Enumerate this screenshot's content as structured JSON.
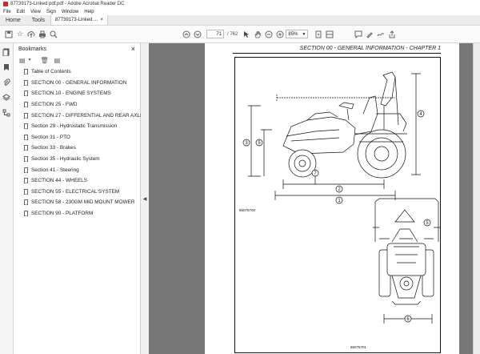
{
  "window": {
    "title": "87739173-Linked pdf.pdf - Adobe Acrobat Reader DC"
  },
  "menu": [
    "File",
    "Edit",
    "View",
    "Sign",
    "Window",
    "Help"
  ],
  "tabs": {
    "home": "Home",
    "tools": "Tools",
    "document": "87739173-Linked ...",
    "close": "×"
  },
  "toolbar": {
    "page_current": "71",
    "page_total": "/ 762",
    "zoom": "85%"
  },
  "bookmarks": {
    "title": "Bookmarks",
    "close": "×",
    "items": [
      "Table of Contents",
      "SECTION 00 - GENERAL INFORMATION",
      "SECTION 10 - ENGINE SYSTEMS",
      "SECTION 25 - FWD",
      "SECTION 27 - DIFFERENTIAL AND REAR AXLES",
      "Section 29 - Hydrostatic Transmission",
      "Section 31 - PTO",
      "Section 33 - Brakes",
      "Section 35 - Hydraulic System",
      "Section 41 - Steering",
      "SECTION 44 - WHEELS",
      "SECTION 55 - ELECTRICAL SYSTEM",
      "SECTION 58 - 230GM MID MOUNT MOWER",
      "SECTION 90 - PLATFORM"
    ]
  },
  "page": {
    "header": "SECTION 00 - GENERAL INFORMATION - CHAPTER 1",
    "fig1_label": "86075700",
    "fig2_label": "86075701",
    "callouts": [
      "1",
      "2",
      "3",
      "4",
      "5",
      "6",
      "7"
    ]
  },
  "icons": {
    "toolbar": [
      "save-icon",
      "bookmark-star-icon",
      "upload-icon",
      "print-icon",
      "zoom-search-icon",
      "page-up-icon",
      "page-down-icon",
      "cursor-icon",
      "hand-icon",
      "zoom-out-icon",
      "zoom-in-icon",
      "fit-page-icon",
      "scroll-mode-icon",
      "comment-icon",
      "highlight-pen-icon",
      "sign-icon",
      "share-icon"
    ],
    "leftrail": [
      "page-thumbnails-icon",
      "bookmarks-icon",
      "attachments-icon",
      "layers-icon",
      "structure-icon"
    ]
  }
}
